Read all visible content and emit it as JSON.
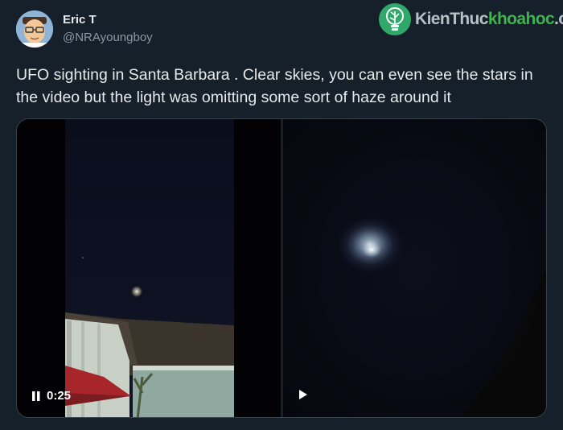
{
  "author": {
    "display_name": "Eric T",
    "handle": "@NRAyoungboy",
    "avatar_icon": "cartoon-avatar"
  },
  "watermark": {
    "text_plain": "KienThuc",
    "text_brand": "khoahoc",
    "domain": ".org",
    "logo_icon": "lightbulb-tree-icon",
    "brand_color": "#3cb54a"
  },
  "tweet": {
    "text": "UFO sighting in Santa Barbara . Clear skies, you can even see the stars in the video but the light was omitting some sort of haze around it"
  },
  "media": {
    "video1": {
      "control_icon": "pause-icon",
      "timestamp": "0:25"
    },
    "video2": {
      "control_icon": "play-icon"
    }
  },
  "colors": {
    "background": "#15202b",
    "text_primary": "#e7e9ea",
    "text_secondary": "#8b98a5",
    "border": "#38444d"
  }
}
